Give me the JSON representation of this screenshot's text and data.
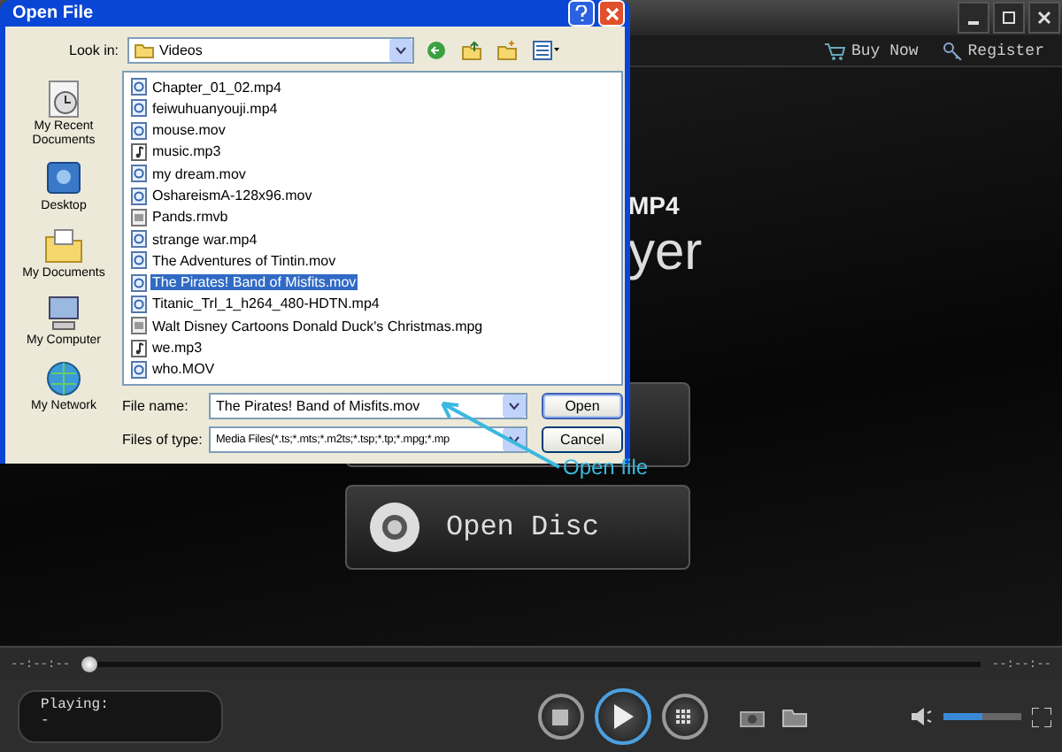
{
  "player": {
    "toolbar": [
      {
        "label": "Buy Now",
        "kind": "cart"
      },
      {
        "label": "Register",
        "kind": "key"
      }
    ],
    "logo": {
      "badge": "MP4",
      "title": "yer"
    },
    "stage_buttons": [
      {
        "kind": "file"
      },
      {
        "label": "Open Disc",
        "kind": "disc"
      }
    ],
    "seek": {
      "elapsed": "--:--:--",
      "total": "--:--:--",
      "level": 0
    },
    "status": {
      "label": "Playing:",
      "value": "-"
    },
    "volume": {
      "level": 0.5
    }
  },
  "annotation": {
    "label": "Open file"
  },
  "dialog": {
    "title": "Open File",
    "look_in_label": "Look in:",
    "look_in_value": "Videos",
    "places": [
      {
        "label": "My Recent Documents",
        "kind": "recent"
      },
      {
        "label": "Desktop",
        "kind": "desktop"
      },
      {
        "label": "My Documents",
        "kind": "documents"
      },
      {
        "label": "My Computer",
        "kind": "computer"
      },
      {
        "label": "My Network",
        "kind": "network"
      }
    ],
    "files": [
      {
        "name": "Chapter_01_02.mp4",
        "kind": "video",
        "selected": false
      },
      {
        "name": "feiwuhuanyouji.mp4",
        "kind": "video",
        "selected": false
      },
      {
        "name": "mouse.mov",
        "kind": "video",
        "selected": false
      },
      {
        "name": "music.mp3",
        "kind": "audio",
        "selected": false
      },
      {
        "name": "my dream.mov",
        "kind": "video",
        "selected": false
      },
      {
        "name": "OshareismA-128x96.mov",
        "kind": "video",
        "selected": false
      },
      {
        "name": "Pands.rmvb",
        "kind": "media",
        "selected": false
      },
      {
        "name": "strange war.mp4",
        "kind": "video",
        "selected": false
      },
      {
        "name": "The Adventures of Tintin.mov",
        "kind": "video",
        "selected": false
      },
      {
        "name": "The Pirates! Band of Misfits.mov",
        "kind": "video",
        "selected": true
      },
      {
        "name": "Titanic_Trl_1_h264_480-HDTN.mp4",
        "kind": "video",
        "selected": false
      },
      {
        "name": "Walt Disney Cartoons Donald Duck's Christmas.mpg",
        "kind": "media",
        "selected": false
      },
      {
        "name": "we.mp3",
        "kind": "audio",
        "selected": false
      },
      {
        "name": "who.MOV",
        "kind": "video",
        "selected": false
      }
    ],
    "fields": [
      {
        "label": "File name:",
        "value": "The Pirates! Band of Misfits.mov"
      },
      {
        "label": "Files of type:",
        "value": "Media Files(*.ts;*.mts;*.m2ts;*.tsp;*.tp;*.mpg;*.mp"
      }
    ],
    "buttons": [
      {
        "label": "Open",
        "default": true
      },
      {
        "label": "Cancel",
        "default": false
      }
    ]
  }
}
